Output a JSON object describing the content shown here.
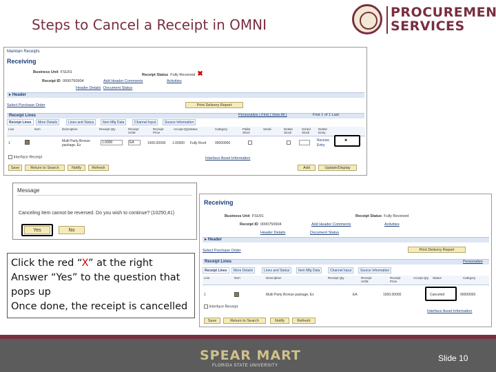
{
  "slide": {
    "title": "Steps to Cancel a Receipt in OMNI",
    "logo_line1": "PROCUREMENT",
    "logo_line2": "SERVICES",
    "slide_number": "Slide 10",
    "footer_brand": "SPEAR MART",
    "footer_sub": "FLORIDA STATE UNIVERSITY"
  },
  "instructions": {
    "line1_prefix": "Click the red “",
    "line1_x": "X",
    "line1_suffix": "” at the right",
    "line2": "Answer “Yes” to the question that pops up",
    "line3": "Once done, the receipt is cancelled"
  },
  "screen1": {
    "breadcrumb": "Maintain Receipts",
    "heading": "Receiving",
    "business_unit_label": "Business Unit",
    "business_unit": "FSU01",
    "receipt_status_label": "Receipt Status",
    "receipt_status": "Fully Received",
    "receipt_id_label": "Receipt ID",
    "receipt_id": "0000750904",
    "add_header_comments": "Add Header Comments",
    "activities": "Activities",
    "header_details": "Header Details",
    "document_status": "Document Status",
    "header_section": "Header",
    "select_po": "Select Purchase Order",
    "print_delivery": "Print Delivery Report",
    "receipt_lines": "Receipt Lines",
    "personalize": "Personalize | Find | View All |",
    "pager": "First  1 of 1  Last",
    "tabs": [
      "Receipt Lines",
      "More Details",
      "Lines and Status",
      "Item Mfg Data",
      "Channel Input",
      "Source Information"
    ],
    "columns": [
      "Line",
      "Item",
      "Description",
      "Receipt Qty",
      "Receipt UOM",
      "Receipt Price",
      "Accept Qty",
      "Status",
      "Category",
      "Pallet Short",
      "Serial",
      "Delete Stock",
      "Sched Stock",
      "Delete Entry"
    ],
    "row": {
      "line": "1",
      "description": "Multi Party Bronze package, Ex",
      "qty": "1.0000",
      "uom": "EA",
      "price": "1500.00000",
      "accept": "1.00000",
      "status": "Fully Rcvd",
      "category": "90000000",
      "receive": "Receive",
      "entry": "Entry"
    },
    "interface_receipt": "Interface Receipt",
    "interface_asset": "Interface Asset Information",
    "buttons": [
      "Save",
      "Return to Search",
      "Notify",
      "Refresh"
    ],
    "add_button": "Add",
    "update_button": "Update/Display"
  },
  "message": {
    "title": "Message",
    "text": "Canceling item cannot be reversed. Do you wish to continue? (10250,41)",
    "yes": "Yes",
    "no": "No"
  },
  "screen3": {
    "heading": "Receiving",
    "business_unit_label": "Business Unit",
    "business_unit": "FSU01",
    "receipt_status_label": "Receipt Status",
    "receipt_status": "Fully Received",
    "receipt_id_label": "Receipt ID",
    "receipt_id": "0000750904",
    "add_header_comments": "Add Header Comments",
    "activities": "Activities",
    "header_details": "Header Details",
    "document_status": "Document Status",
    "header_section": "Header",
    "select_po": "Select Purchase Order",
    "print_delivery": "Print Delivery Report",
    "receipt_lines": "Receipt Lines",
    "personalize": "Personalize",
    "tabs": [
      "Receipt Lines",
      "More Details",
      "Lines and Status",
      "Item Mfg Data",
      "Channel Input",
      "Source Information"
    ],
    "columns": [
      "Line",
      "Item",
      "Description",
      "Receipt Qty",
      "Receipt UOM",
      "Receipt Price",
      "Accept Qty",
      "Status",
      "Category"
    ],
    "row": {
      "line": "1",
      "description": "Multi Party Bronze package, Ex",
      "uom": "EA",
      "price": "1500.00000",
      "status": "Canceled",
      "category": "90000000"
    },
    "interface_receipt": "Interface Receipt",
    "interface_asset": "Interface Asset Information",
    "buttons": [
      "Save",
      "Return to Search",
      "Notify",
      "Refresh"
    ]
  }
}
